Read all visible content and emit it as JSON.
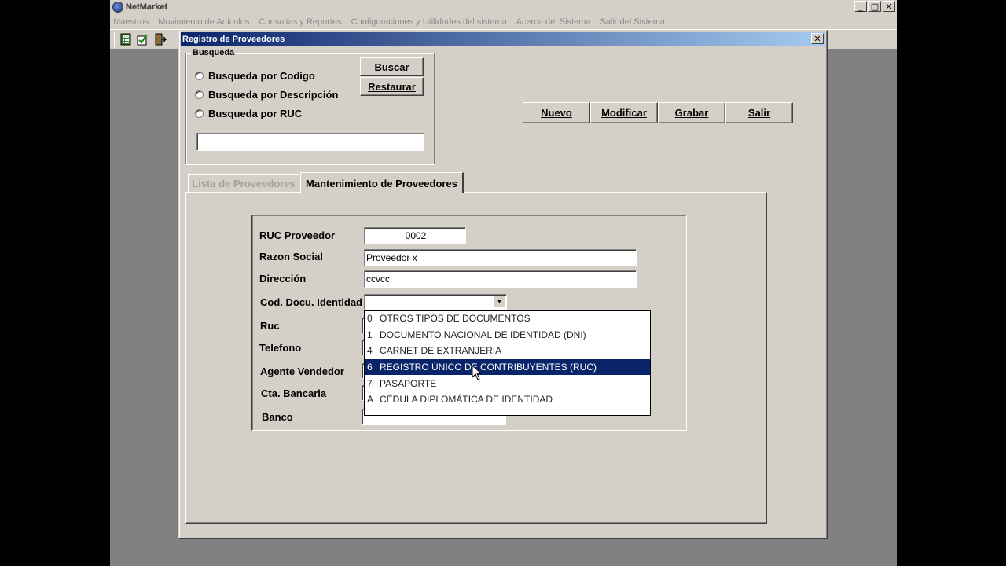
{
  "app": {
    "title": "NetMarket",
    "menu": [
      "Maestros",
      "Movimiento de Articulos",
      "Consultas y Reportes",
      "Configuraciones y Utilidades del sistema",
      "Acerca del Sistema",
      "Salir del Sistema"
    ]
  },
  "window": {
    "title": "Registro de Proveedores"
  },
  "search": {
    "group_label": "Busqueda",
    "option_codigo": "Busqueda por Codigo",
    "option_descripcion": "Busqueda por Descripción",
    "option_ruc": "Busqueda por RUC",
    "value": "",
    "buscar_label": "Buscar",
    "restaurar_label": "Restaurar"
  },
  "actions": {
    "nuevo": "Nuevo",
    "modificar": "Modificar",
    "grabar": "Grabar",
    "salir": "Salir"
  },
  "tabs": {
    "lista": "Lista de Proveedores",
    "mantenimiento": "Mantenimiento de Proveedores"
  },
  "form": {
    "ruc_label": "RUC Proveedor",
    "ruc_value": "0002",
    "razon_label": "Razon Social",
    "razon_value": "Proveedor x",
    "direccion_label": "Dirección",
    "direccion_value": "ccvcc",
    "docu_label": "Cod. Docu. Identidad",
    "docu_value": "",
    "ruc2_label": "Ruc",
    "telefono_label": "Telefono",
    "agente_label": "Agente Vendedor",
    "cta_label": "Cta. Bancaria",
    "banco_label": "Banco"
  },
  "dropdown": {
    "items": [
      {
        "code": "0",
        "text": "OTROS TIPOS DE DOCUMENTOS"
      },
      {
        "code": "1",
        "text": "DOCUMENTO NACIONAL DE IDENTIDAD (DNI)"
      },
      {
        "code": "4",
        "text": "CARNET DE EXTRANJERIA"
      },
      {
        "code": "6",
        "text": "REGISTRO ÚNICO DE CONTRIBUYENTES (RUC)"
      },
      {
        "code": "7",
        "text": "PASAPORTE"
      },
      {
        "code": "A",
        "text": "CÉDULA DIPLOMÁTICA DE IDENTIDAD"
      }
    ],
    "selected_index": 3
  },
  "colors": {
    "title_gradient_start": "#0a246a",
    "title_gradient_end": "#a6caf0",
    "face": "#d4d0c8",
    "workspace": "#808080"
  }
}
